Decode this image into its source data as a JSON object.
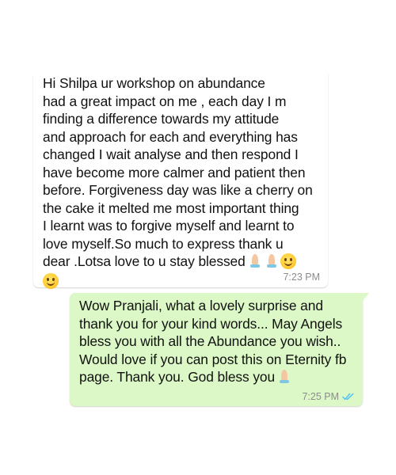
{
  "conversation": {
    "incoming": {
      "text": "Hi Shilpa ur workshop on abundance\nhad  a great impact on me , each day I m\nfinding a difference  towards my attitude\nand approach for each and everything has\nchanged I wait analyse and then respond I\nhave become more calmer and patient then\nbefore. Forgiveness day was like a cherry on\nthe cake it melted me most important  thing\nI learnt was to forgive myself and learnt to\nlove myself.So much to express thank u\ndear .Lotsa love to u stay blessed",
      "emojis": [
        "folded-hands",
        "folded-hands",
        "smiling-face",
        "smiling-face"
      ],
      "time": "7:23 PM"
    },
    "outgoing": {
      "text": "Wow Pranjali, what a lovely surprise and\nthank you for your kind words... May Angels\nbless you with all the Abundance you wish..\nWould love if you can post this on Eternity fb\npage. Thank you. God bless you",
      "emojis": [
        "folded-hands"
      ],
      "time": "7:25 PM",
      "status": "read",
      "tick_color": "#4fc3f7"
    }
  },
  "colors": {
    "incoming_bg": "#ffffff",
    "outgoing_bg": "#dcf8c6",
    "text": "#111111",
    "meta": "#8c8c8c"
  }
}
